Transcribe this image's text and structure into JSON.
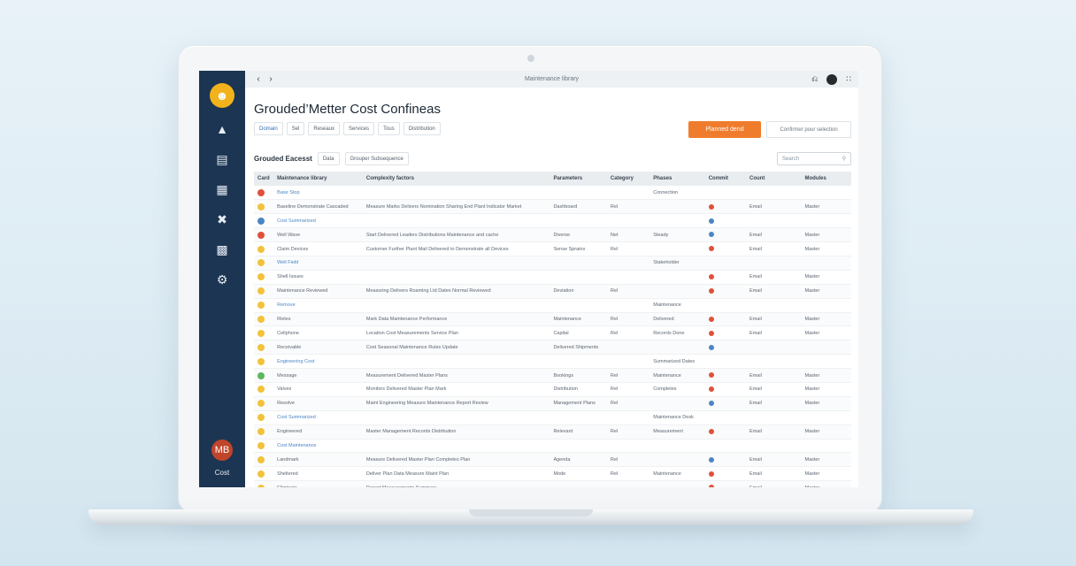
{
  "window": {
    "title": "Maintenance library"
  },
  "page": {
    "title": "Grouded’Metter Cost Confineas"
  },
  "filters": [
    {
      "label": "Domain",
      "active": true
    },
    {
      "label": "Sel",
      "active": false
    },
    {
      "label": "Reseaux",
      "active": false
    },
    {
      "label": "Services",
      "active": false
    },
    {
      "label": "Tous",
      "active": false
    },
    {
      "label": "Distribution",
      "active": false
    }
  ],
  "actions": {
    "primary": "Planned dend",
    "secondary": "Confirmer pour selection"
  },
  "section": {
    "title": "Grouded Eacesst",
    "tabs": [
      "Data",
      "Grouper Subsequence"
    ]
  },
  "search": {
    "placeholder": "Search"
  },
  "sidebar": {
    "user_label": "Cost",
    "user_initials": "MB"
  },
  "colors": {
    "sidebar": "#1c3553",
    "accent": "#ef7c2c",
    "logo": "#f2b21c",
    "status_red": "#e0503a",
    "status_blue": "#4a86c5",
    "row_yellow": "#f2c23a",
    "row_green": "#5cb85c"
  },
  "table": {
    "columns": [
      "Card",
      "Maintenance library",
      "Complexity factors",
      "Parameters",
      "Category",
      "Phases",
      "Commit",
      "Count",
      "Modules"
    ],
    "rows": [
      {
        "dot": "red",
        "name": "Base Stop",
        "desc": "",
        "param": "",
        "cat": "",
        "phase": "Connection",
        "commit": "",
        "count": "",
        "module": "",
        "group": true
      },
      {
        "dot": "yellow",
        "name": "Baseline Demonstrate Cascaded",
        "desc": "Measure Marks Delivers Nomination Sharing End Plant Indicator Market",
        "param": "Dashboard",
        "cat": "Rel",
        "phase": "",
        "commit": "red",
        "count": "Email",
        "module": "Master"
      },
      {
        "dot": "blue",
        "name": "Cost Summarized",
        "desc": "",
        "param": "",
        "cat": "",
        "phase": "",
        "commit": "blue",
        "count": "",
        "module": "",
        "group": true
      },
      {
        "dot": "red",
        "name": "Well Wave",
        "desc": "Start Delivered Leaders Distributions Maintenance and cache",
        "param": "Diverse",
        "cat": "Net",
        "phase": "Steady",
        "commit": "blue",
        "count": "Email",
        "module": "Master"
      },
      {
        "dot": "yellow",
        "name": "Claim Devices",
        "desc": "Customer Further Plant Mail Delivered to Demonstrate all Devices",
        "param": "Sense Sprains",
        "cat": "Rel",
        "phase": "",
        "commit": "red",
        "count": "Email",
        "module": "Master"
      },
      {
        "dot": "yellow",
        "name": "Well Field",
        "desc": "",
        "param": "",
        "cat": "",
        "phase": "Stakeholder",
        "commit": "",
        "count": "",
        "module": "",
        "group": true
      },
      {
        "dot": "yellow",
        "name": "Shell Issues",
        "desc": "",
        "param": "",
        "cat": "",
        "phase": "",
        "commit": "red",
        "count": "Email",
        "module": "Master"
      },
      {
        "dot": "yellow",
        "name": "Maintenance Reviewed",
        "desc": "Measuring Delivers Roaming Ltd Dates Normal Reviewed",
        "param": "Deviation",
        "cat": "Rel",
        "phase": "",
        "commit": "red",
        "count": "Email",
        "module": "Master"
      },
      {
        "dot": "yellow",
        "name": "Remove",
        "desc": "",
        "param": "",
        "cat": "",
        "phase": "Maintenance",
        "commit": "",
        "count": "",
        "module": "",
        "group": true
      },
      {
        "dot": "yellow",
        "name": "Rieles",
        "desc": "Mark Data Maintenance Performance",
        "param": "Maintenance",
        "cat": "Rel",
        "phase": "Delivered",
        "commit": "red",
        "count": "Email",
        "module": "Master"
      },
      {
        "dot": "yellow",
        "name": "Cellphone",
        "desc": "Location Cost Measurements Service Plan",
        "param": "Capital",
        "cat": "Rel",
        "phase": "Records Done",
        "commit": "red",
        "count": "Email",
        "module": "Master"
      },
      {
        "dot": "yellow",
        "name": "Receivable",
        "desc": "Cost Seasonal Maintenance Rules Update",
        "param": "Delivered Shipments",
        "cat": "",
        "phase": "",
        "commit": "blue",
        "count": "",
        "module": "",
        "group": false
      },
      {
        "dot": "yellow",
        "name": "Engineering Cost",
        "desc": "",
        "param": "",
        "cat": "",
        "phase": "Summarized Dates",
        "commit": "",
        "count": "",
        "module": "",
        "group": true
      },
      {
        "dot": "green",
        "name": "Message",
        "desc": "Measurement Delivered Master Plans",
        "param": "Bookings",
        "cat": "Rel",
        "phase": "Maintenance",
        "commit": "red",
        "count": "Email",
        "module": "Master"
      },
      {
        "dot": "yellow",
        "name": "Valves",
        "desc": "Monitors Delivered Master Plan Mark",
        "param": "Distribution",
        "cat": "Rel",
        "phase": "Completes",
        "commit": "red",
        "count": "Email",
        "module": "Master"
      },
      {
        "dot": "yellow",
        "name": "Resolve",
        "desc": "Maint Engineering Measure Maintenance Report Review",
        "param": "Management Plans",
        "cat": "Rel",
        "phase": "",
        "commit": "blue",
        "count": "Email",
        "module": "Master"
      },
      {
        "dot": "yellow",
        "name": "Cost Summarized",
        "desc": "",
        "param": "",
        "cat": "",
        "phase": "Maintenance Desk",
        "commit": "",
        "count": "",
        "module": "",
        "group": true
      },
      {
        "dot": "yellow",
        "name": "Engineered",
        "desc": "Master Management Records Distribution",
        "param": "Relevant",
        "cat": "Rel",
        "phase": "Measurement",
        "commit": "red",
        "count": "Email",
        "module": "Master"
      },
      {
        "dot": "yellow",
        "name": "Cost Maintenance",
        "desc": "",
        "param": "",
        "cat": "",
        "phase": "",
        "commit": "",
        "count": "",
        "module": "",
        "group": true
      },
      {
        "dot": "yellow",
        "name": "Landmark",
        "desc": "Measure Delivered Master Plan Completes Plan",
        "param": "Agenda",
        "cat": "Rel",
        "phase": "",
        "commit": "blue",
        "count": "Email",
        "module": "Master"
      },
      {
        "dot": "yellow",
        "name": "Sheltered",
        "desc": "Deliver Plan Data Measure Maint Plan",
        "param": "Mode",
        "cat": "Rel",
        "phase": "Maintenance",
        "commit": "red",
        "count": "Email",
        "module": "Master"
      },
      {
        "dot": "yellow",
        "name": "Eliminate",
        "desc": "Report Measurements Summary",
        "param": "",
        "cat": "",
        "phase": "",
        "commit": "red",
        "count": "Email",
        "module": "Master"
      }
    ]
  }
}
